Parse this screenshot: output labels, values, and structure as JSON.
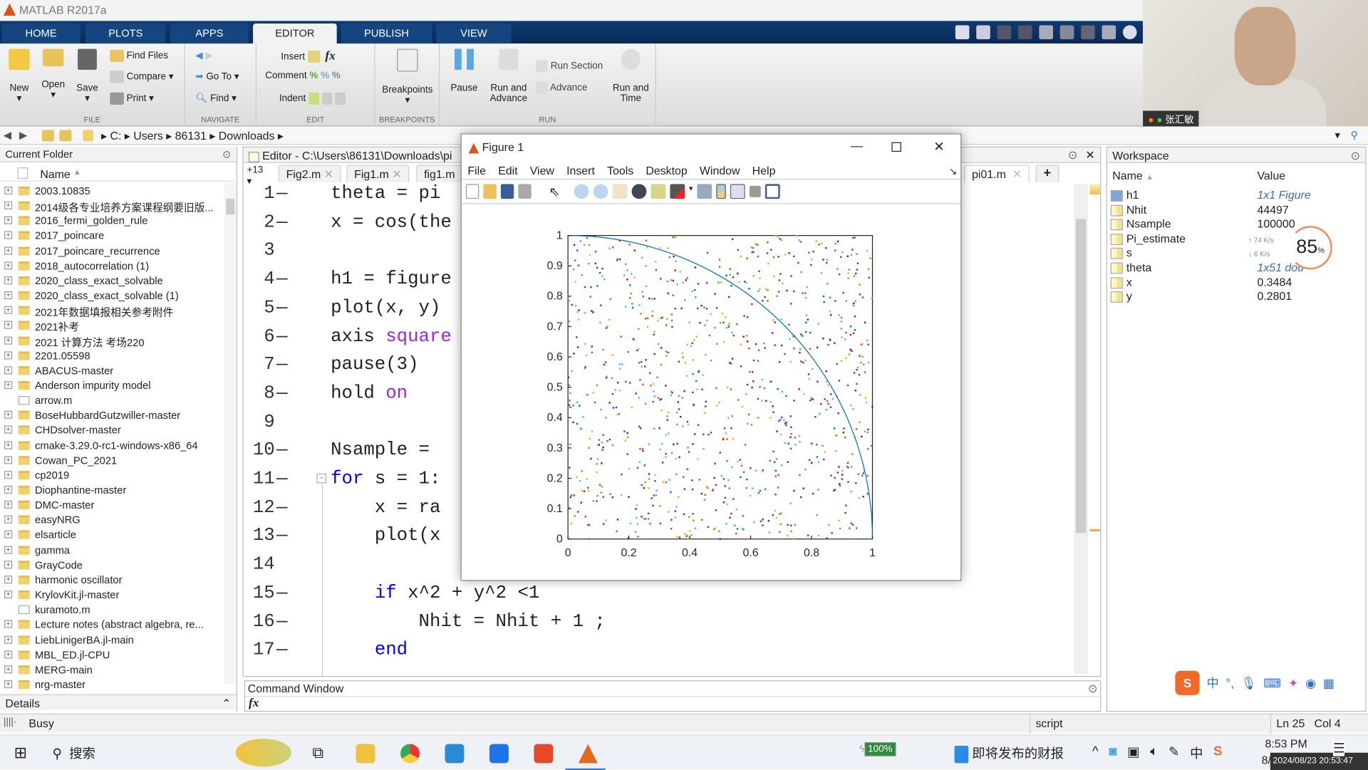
{
  "app": {
    "title": "MATLAB R2017a"
  },
  "ribbon": {
    "tabs": [
      "HOME",
      "PLOTS",
      "APPS",
      "EDITOR",
      "PUBLISH",
      "VIEW"
    ],
    "active_tab": "EDITOR",
    "file": {
      "label": "FILE",
      "new": "New",
      "open": "Open",
      "save": "Save",
      "find_files": "Find Files",
      "compare": "Compare",
      "print": "Print"
    },
    "navigate": {
      "label": "NAVIGATE",
      "goto": "Go To",
      "find": "Find"
    },
    "edit": {
      "label": "EDIT",
      "insert": "Insert",
      "comment": "Comment",
      "indent": "Indent",
      "fx": "fx"
    },
    "breakpoints": {
      "label": "BREAKPOINTS",
      "button": "Breakpoints"
    },
    "run": {
      "label": "RUN",
      "pause": "Pause",
      "run_and_advance": "Run and Advance",
      "run_section": "Run Section",
      "advance": "Advance",
      "run_and_time": "Run and Time"
    }
  },
  "webcam": {
    "name": "张汇敏"
  },
  "address": {
    "path": [
      "C:",
      "Users",
      "86131",
      "Downloads"
    ]
  },
  "current_folder": {
    "title": "Current Folder",
    "column": "Name",
    "items": [
      "2003.10835",
      "2014级各专业培养方案课程纲要旧版...",
      "2016_fermi_golden_rule",
      "2017_poincare",
      "2017_poincare_recurrence",
      "2018_autocorrelation (1)",
      "2020_class_exact_solvable",
      "2020_class_exact_solvable (1)",
      "2021年数据填报相关参考附件",
      "2021补考",
      "2021 计算方法 考场220",
      "2201.05598",
      "ABACUS-master",
      "Anderson impurity model",
      "arrow.m",
      "BoseHubbardGutzwiller-master",
      "CHDsolver-master",
      "cmake-3.29.0-rc1-windows-x86_64",
      "Cowan_PC_2021",
      "cp2019",
      "Diophantine-master",
      "DMC-master",
      "easyNRG",
      "elsarticle",
      "gamma",
      "GrayCode",
      "harmonic oscillator",
      "KrylovKit.jl-master",
      "kuramoto.m",
      "Lecture notes (abstract algebra, re...",
      "LiebLinigerBA.jl-main",
      "MBL_ED.jl-CPU",
      "MERG-main",
      "nrg-master"
    ],
    "details": "Details"
  },
  "editor": {
    "title": "Editor - C:\\Users\\86131\\Downloads\\pi",
    "tab_count": "+13",
    "tabs": [
      "Fig2.m",
      "Fig1.m",
      "fig1.m",
      "pi01.m"
    ],
    "lines": [
      {
        "n": "1",
        "dash": "—",
        "code": [
          {
            "t": "theta = pi"
          }
        ]
      },
      {
        "n": "2",
        "dash": "—",
        "code": [
          {
            "t": "x = cos(the"
          }
        ]
      },
      {
        "n": "3",
        "dash": "",
        "code": []
      },
      {
        "n": "4",
        "dash": "—",
        "code": [
          {
            "t": "h1 = figure"
          }
        ]
      },
      {
        "n": "5",
        "dash": "—",
        "code": [
          {
            "t": "plot(x, y)"
          }
        ]
      },
      {
        "n": "6",
        "dash": "—",
        "code": [
          {
            "t": "axis "
          },
          {
            "t": "square",
            "c": "str"
          }
        ]
      },
      {
        "n": "7",
        "dash": "—",
        "code": [
          {
            "t": "pause(3)"
          }
        ]
      },
      {
        "n": "8",
        "dash": "—",
        "code": [
          {
            "t": "hold "
          },
          {
            "t": "on",
            "c": "str"
          }
        ]
      },
      {
        "n": "9",
        "dash": "",
        "code": []
      },
      {
        "n": "10",
        "dash": "—",
        "code": [
          {
            "t": "Nsample = "
          }
        ]
      },
      {
        "n": "11",
        "dash": "—",
        "code": [
          {
            "t": "for",
            "c": "kw"
          },
          {
            "t": " s = 1:"
          }
        ]
      },
      {
        "n": "12",
        "dash": "—",
        "code": [
          {
            "t": "    x = ra"
          }
        ]
      },
      {
        "n": "13",
        "dash": "—",
        "code": [
          {
            "t": "    plot(x"
          }
        ]
      },
      {
        "n": "14",
        "dash": "",
        "code": []
      },
      {
        "n": "15",
        "dash": "—",
        "code": [
          {
            "t": "    "
          },
          {
            "t": "if",
            "c": "kw"
          },
          {
            "t": " x^2 + y^2 <1"
          }
        ]
      },
      {
        "n": "16",
        "dash": "—",
        "code": [
          {
            "t": "        Nhit = Nhit + 1 ;"
          }
        ]
      },
      {
        "n": "17",
        "dash": "—",
        "code": [
          {
            "t": "    "
          },
          {
            "t": "end",
            "c": "kw"
          }
        ]
      }
    ]
  },
  "figure": {
    "title": "Figure 1",
    "menu": [
      "File",
      "Edit",
      "View",
      "Insert",
      "Tools",
      "Desktop",
      "Window",
      "Help"
    ]
  },
  "chart_data": {
    "type": "scatter",
    "xlim": [
      0,
      1
    ],
    "ylim": [
      0,
      1
    ],
    "xticks": [
      "0",
      "0.2",
      "0.4",
      "0.6",
      "0.8",
      "1"
    ],
    "yticks": [
      "0",
      "0.1",
      "0.2",
      "0.3",
      "0.4",
      "0.5",
      "0.6",
      "0.7",
      "0.8",
      "0.9",
      "1"
    ],
    "curve": "quarter circle x^2+y^2=1",
    "curve_color": "#0072bd",
    "point_distribution": "uniform random in [0,1]x[0,1]",
    "point_colors": [
      "#0072bd",
      "#d95319",
      "#edb120",
      "#7e2f8e",
      "#77ac30",
      "#4dbeee",
      "#a2142f"
    ],
    "grid": false
  },
  "command_window": {
    "title": "Command Window",
    "prompt": "fx"
  },
  "workspace": {
    "title": "Workspace",
    "col_name": "Name",
    "col_value": "Value",
    "vars": [
      {
        "name": "h1",
        "value": "1x1 Figure",
        "italic": true
      },
      {
        "name": "Nhit",
        "value": "44497"
      },
      {
        "name": "Nsample",
        "value": "100000"
      },
      {
        "name": "Pi_estimate",
        "value": ""
      },
      {
        "name": "s",
        "value": ""
      },
      {
        "name": "theta",
        "value": "1x51 dou",
        "italic": true
      },
      {
        "name": "x",
        "value": "0.3484"
      },
      {
        "name": "y",
        "value": "0.2801"
      }
    ]
  },
  "net_widget": {
    "up": "74",
    "down": "6",
    "unit": "K/s",
    "percent": "85",
    "percent_sign": "%"
  },
  "status": {
    "busy": "Busy",
    "type": "script",
    "ln_label": "Ln",
    "ln": "25",
    "col_label": "Col",
    "col": "4"
  },
  "taskbar": {
    "search": "搜索",
    "battery": "100%",
    "news": "即将发布的财报",
    "ime": "中",
    "time": "8:53 PM",
    "date": "8/",
    "timestamp": "2024/08/23 20:53:47"
  }
}
